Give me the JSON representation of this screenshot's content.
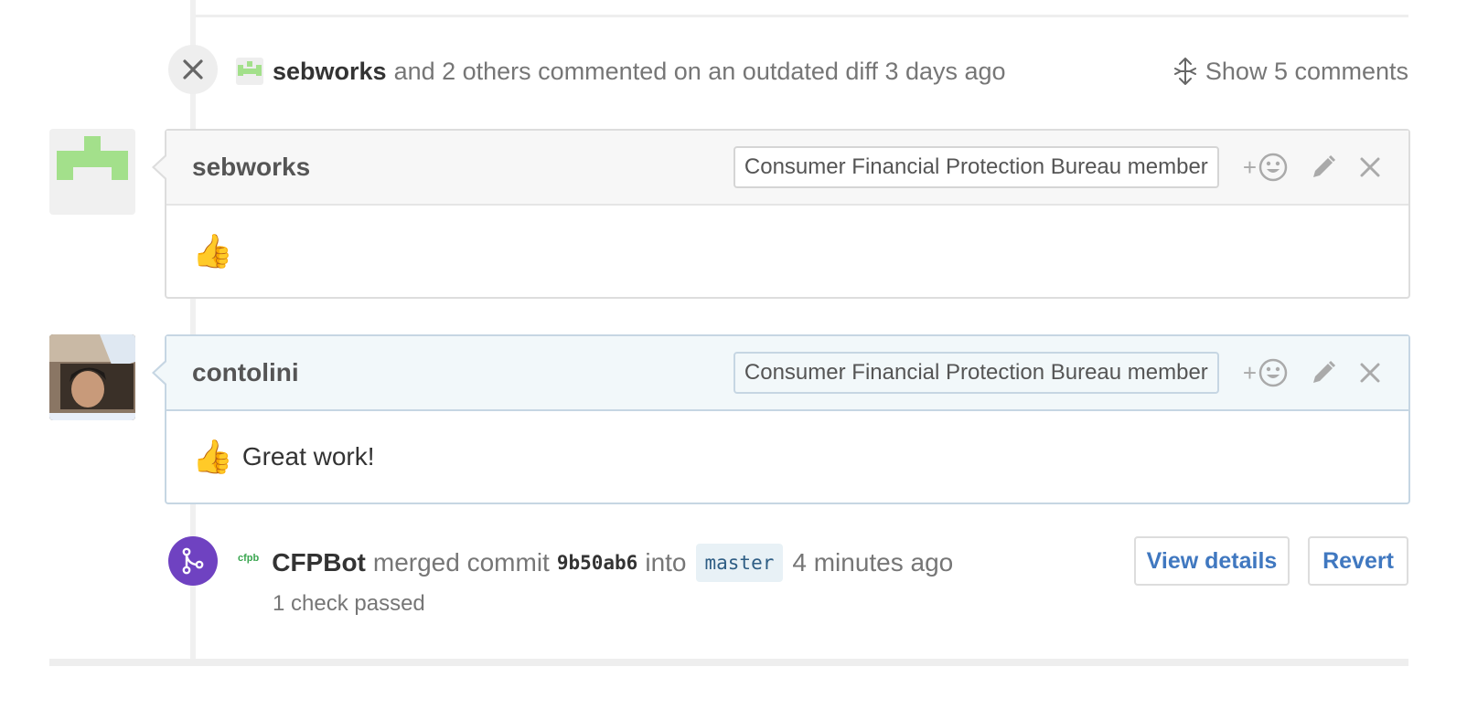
{
  "outdated": {
    "author": "sebworks",
    "rest": "and 2 others commented on an outdated diff 3 days ago",
    "show_comments": "Show 5 comments"
  },
  "comments": [
    {
      "author": "sebworks",
      "member_label": "Consumer Financial Protection Bureau member",
      "emoji": "👍",
      "text": ""
    },
    {
      "author": "contolini",
      "member_label": "Consumer Financial Protection Bureau member",
      "emoji": "👍",
      "text": "Great work!"
    }
  ],
  "merge": {
    "bot_logo": "cfpb",
    "bot": "CFPBot",
    "merged_commit": "merged commit",
    "sha": "9b50ab6",
    "into": "into",
    "branch": "master",
    "time": "4 minutes ago",
    "checks": "1 check passed",
    "view_details": "View details",
    "revert": "Revert"
  },
  "colors": {
    "merge_badge": "#6f42c1",
    "link": "#4078c0",
    "identicon": "#a3e08b"
  },
  "icons": [
    "close-icon",
    "unfold-icon",
    "add-reaction-icon",
    "pencil-icon",
    "git-merge-icon"
  ]
}
